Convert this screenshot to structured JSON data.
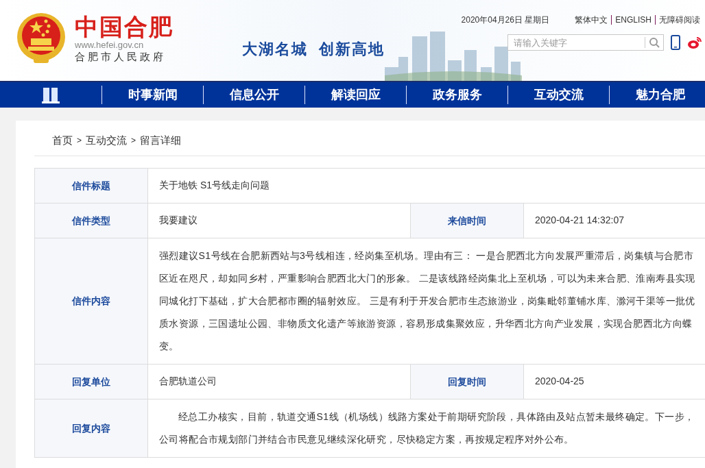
{
  "header": {
    "site_name": "中国合肥",
    "url": "www.hefei.gov.cn",
    "org": "合肥市人民政府",
    "slogan": [
      "大湖名城",
      "创新高地"
    ],
    "date": "2020年04月26日 星期日",
    "lang_links": [
      "繁体中文",
      "ENGLISH",
      "无障碍阅读"
    ],
    "search": {
      "placeholder": "请输入关键字"
    }
  },
  "nav": {
    "items": [
      {
        "kind": "icon"
      },
      {
        "kind": "text",
        "label": "时事新闻"
      },
      {
        "kind": "text",
        "label": "信息公开"
      },
      {
        "kind": "text",
        "label": "解读回应"
      },
      {
        "kind": "text",
        "label": "政务服务"
      },
      {
        "kind": "text",
        "label": "互动交流"
      },
      {
        "kind": "text",
        "label": "魅力合肥"
      }
    ]
  },
  "breadcrumb": {
    "separator": ">",
    "items": [
      "首页",
      "互动交流",
      "留言详细"
    ]
  },
  "table": {
    "rows": [
      {
        "kind": "single",
        "label": "信件标题",
        "value": "关于地铁 S1号线走向问题"
      },
      {
        "kind": "pair",
        "label": "信件类型",
        "value": "我要建议",
        "label_2": "来信时间",
        "value_2": "2020-04-21 14:32:07"
      },
      {
        "kind": "text",
        "label": "信件内容",
        "value": "强烈建议S1号线在合肥新西站与3号线相连，经岗集至机场。理由有三： 一是合肥西北方向发展严重滞后，岗集镇与合肥市区近在咫尺，却如同乡村，严重影响合肥西北大门的形象。 二是该线路经岗集北上至机场，可以为未来合肥、淮南寿县实现同城化打下基础，扩大合肥都市圈的辐射效应。 三是有利于开发合肥市生态旅游业，岗集毗邻董铺水库、滁河干渠等一批优质水资源，三国遗址公园、非物质文化遗产等旅游资源，容易形成集聚效应，升华西北方向产业发展，实现合肥西北方向蝶变。"
      },
      {
        "kind": "pair",
        "label": "回复单位",
        "value": "合肥轨道公司",
        "label_2": "回复时间",
        "value_2": "2020-04-25"
      },
      {
        "kind": "indented_text",
        "label": "回复内容",
        "value": "经总工办核实，目前，轨道交通S1线（机场线）线路方案处于前期研究阶段，具体路由及站点暂未最终确定。下一步，公司将配合市规划部门并结合市民意见继续深化研究，尽快稳定方案，再按规定程序对外公布。"
      }
    ]
  }
}
